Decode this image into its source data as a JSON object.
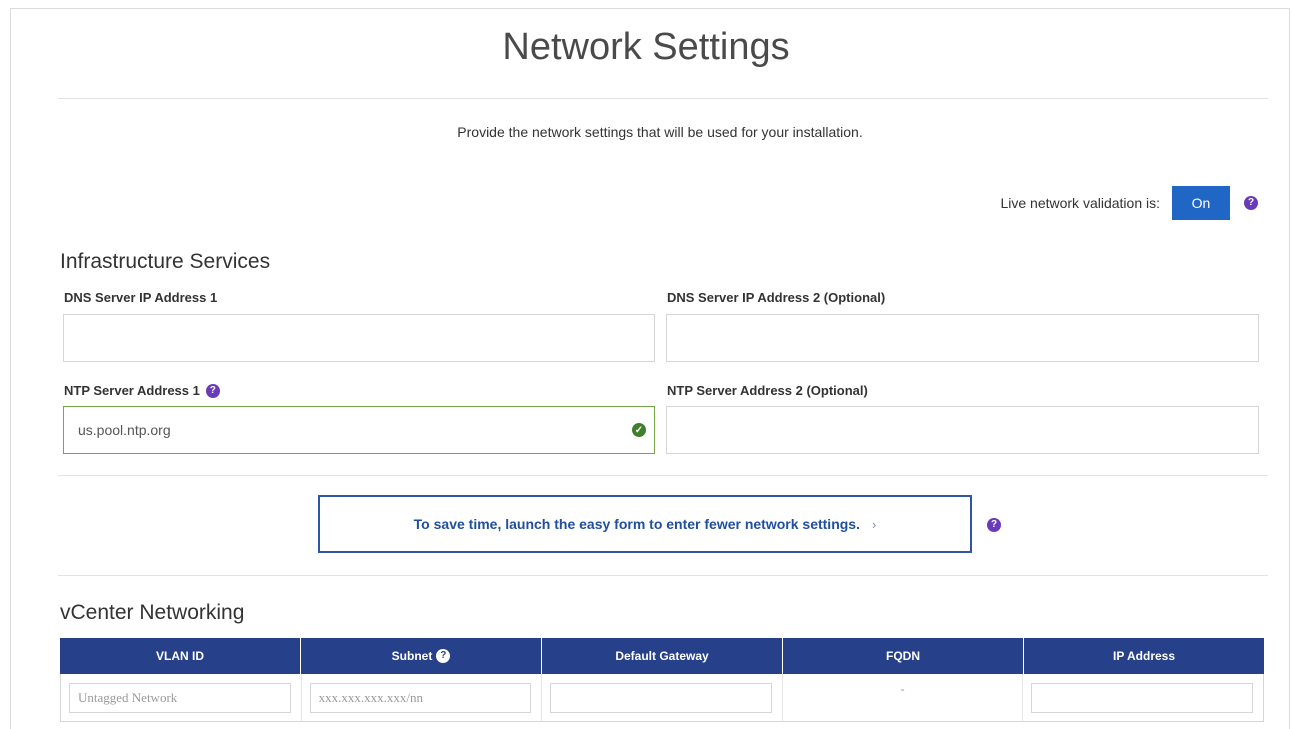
{
  "page": {
    "title": "Network Settings",
    "subtitle": "Provide the network settings that will be used for your installation."
  },
  "validation": {
    "label": "Live network validation is:",
    "button": "On",
    "help_icon": "question-circle-icon"
  },
  "infrastructure": {
    "title": "Infrastructure Services",
    "dns1": {
      "label": "DNS Server IP Address 1",
      "value": ""
    },
    "dns2": {
      "label": "DNS Server IP Address 2 (Optional)",
      "value": ""
    },
    "ntp1": {
      "label": "NTP Server Address 1",
      "value": "us.pool.ntp.org",
      "status_icon": "check-circle-icon"
    },
    "ntp2": {
      "label": "NTP Server Address 2 (Optional)",
      "value": ""
    }
  },
  "easy_form": {
    "text": "To save time, launch the easy form to enter fewer network settings.",
    "chevron": "›"
  },
  "vcenter": {
    "title": "vCenter Networking",
    "columns": [
      "VLAN ID",
      "Subnet",
      "Default Gateway",
      "FQDN",
      "IP Address"
    ],
    "row": {
      "vlan_placeholder": "Untagged Network",
      "subnet_placeholder": "xxx.xxx.xxx.xxx/nn",
      "gateway": "",
      "fqdn": "-",
      "ip": ""
    }
  },
  "colors": {
    "accent": "#1f66c5",
    "help": "#6a3bb8",
    "table_header": "#26408a",
    "valid": "#3f7f2b"
  }
}
